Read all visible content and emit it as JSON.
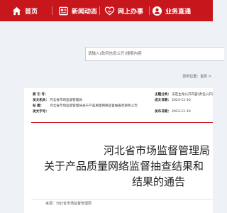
{
  "nav": {
    "items": [
      {
        "label": "首页",
        "icon": "home-icon"
      },
      {
        "label": "新闻动态",
        "icon": "news-icon"
      },
      {
        "label": "网上办事",
        "icon": "heart-hands-icon"
      },
      {
        "label": "业务直通",
        "icon": "user-icon"
      }
    ]
  },
  "search": {
    "placeholder": "请输入(政府信息公开)搜索内容"
  },
  "location": "您的位置：首页 >",
  "document": {
    "meta": {
      "index_label": "索 引 号：",
      "index_value": "",
      "category_label": "主题分类：",
      "category_value": "法定主动公开内容(责任公开)",
      "issuer_label": "发文机关：",
      "issuer_value": "河北省市场监督管理局",
      "date_label": "成文日期：",
      "date_value": "2023-11-10",
      "title_label": "标    题：",
      "title_value": "河北省市场监督管理局关于产品质量网络监督抽查结果和公告",
      "publish_label": "发布日期：",
      "publish_value": "2023-11-10",
      "extra_label": "发文字号：",
      "extra_value": ""
    },
    "heading_line1": "河北省市场监督管理局",
    "heading_line2": "关于产品质量网络监督抽查结果和",
    "heading_line3": "结果的通告",
    "source": "来源：河北省市场监督管理局"
  }
}
